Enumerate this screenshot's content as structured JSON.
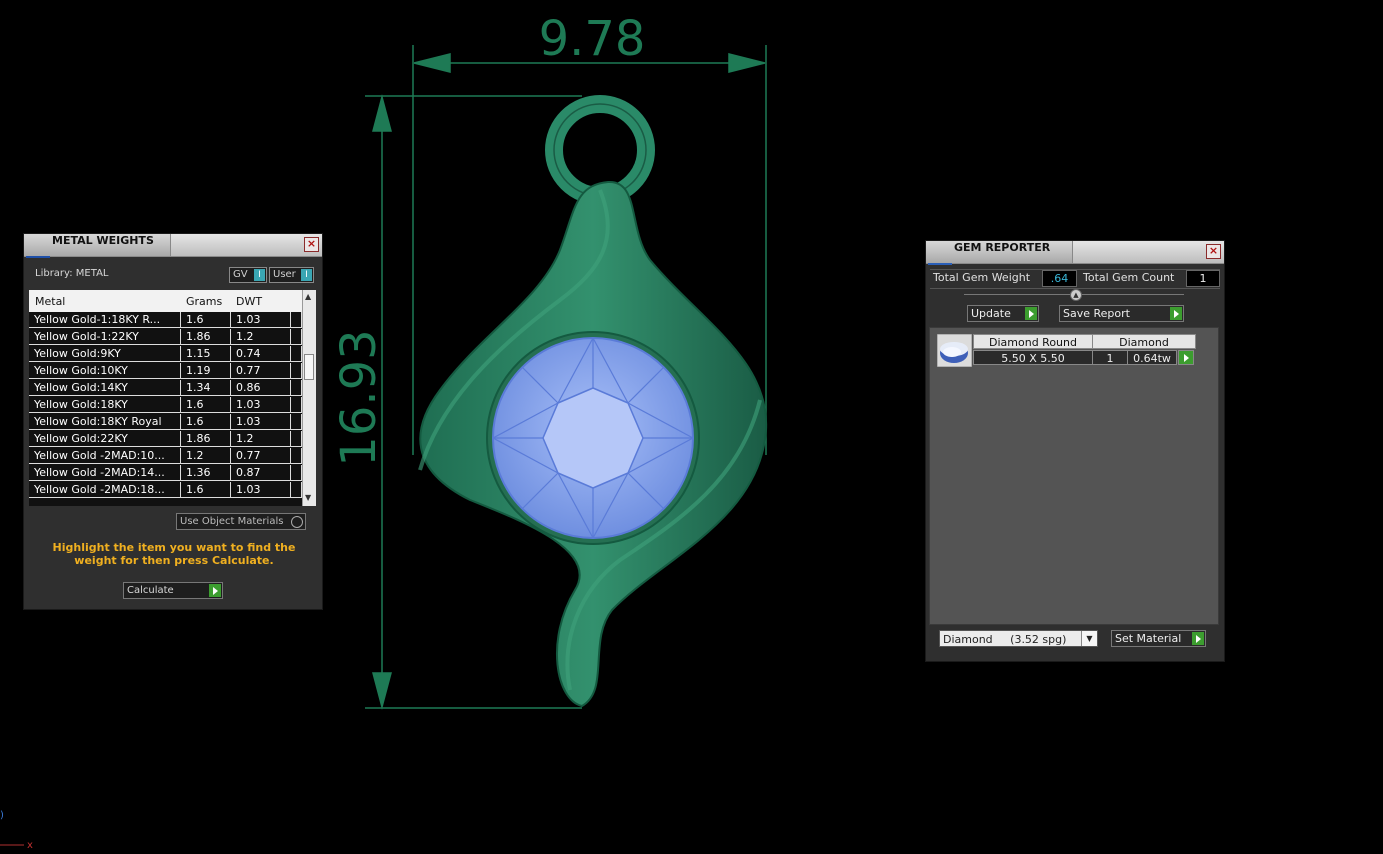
{
  "dimensions": {
    "width_value": "9.78",
    "height_value": "16.93"
  },
  "colors": {
    "dimension_green": "#1e7a55",
    "pendant_green": "#2a8a68",
    "gem_blue": "#8aa8f0",
    "hint_yellow": "#f0b020",
    "go_green": "#3c9d2f"
  },
  "metal_weights": {
    "title": "METAL WEIGHTS",
    "library_label": "Library: METAL",
    "gv_toggle": "GV",
    "user_toggle": "User",
    "columns": [
      "Metal",
      "Grams",
      "DWT"
    ],
    "rows": [
      [
        "Yellow Gold-1:18KY R...",
        "1.6",
        "1.03"
      ],
      [
        "Yellow Gold-1:22KY",
        "1.86",
        "1.2"
      ],
      [
        "Yellow Gold:9KY",
        "1.15",
        "0.74"
      ],
      [
        "Yellow Gold:10KY",
        "1.19",
        "0.77"
      ],
      [
        "Yellow Gold:14KY",
        "1.34",
        "0.86"
      ],
      [
        "Yellow Gold:18KY",
        "1.6",
        "1.03"
      ],
      [
        "Yellow Gold:18KY Royal",
        "1.6",
        "1.03"
      ],
      [
        "Yellow Gold:22KY",
        "1.86",
        "1.2"
      ],
      [
        "Yellow Gold -2MAD:10...",
        "1.2",
        "0.77"
      ],
      [
        "Yellow Gold -2MAD:14...",
        "1.36",
        "0.87"
      ],
      [
        "Yellow Gold -2MAD:18...",
        "1.6",
        "1.03"
      ]
    ],
    "use_object_materials": "Use Object Materials",
    "hint": "Highlight the item you want to find the weight for then press Calculate.",
    "calculate_label": "Calculate"
  },
  "gem_reporter": {
    "title": "GEM REPORTER",
    "total_weight_label": "Total Gem Weight",
    "total_weight_value": ".64",
    "total_count_label": "Total Gem Count",
    "total_count_value": "1",
    "update_label": "Update",
    "save_report_label": "Save Report",
    "gem": {
      "shape": "Diamond Round",
      "material": "Diamond",
      "size": "5.50 X 5.50",
      "count": "1",
      "weight": "0.64tw"
    },
    "material_select": "Diamond     (3.52 spg)",
    "set_material_label": "Set Material"
  }
}
